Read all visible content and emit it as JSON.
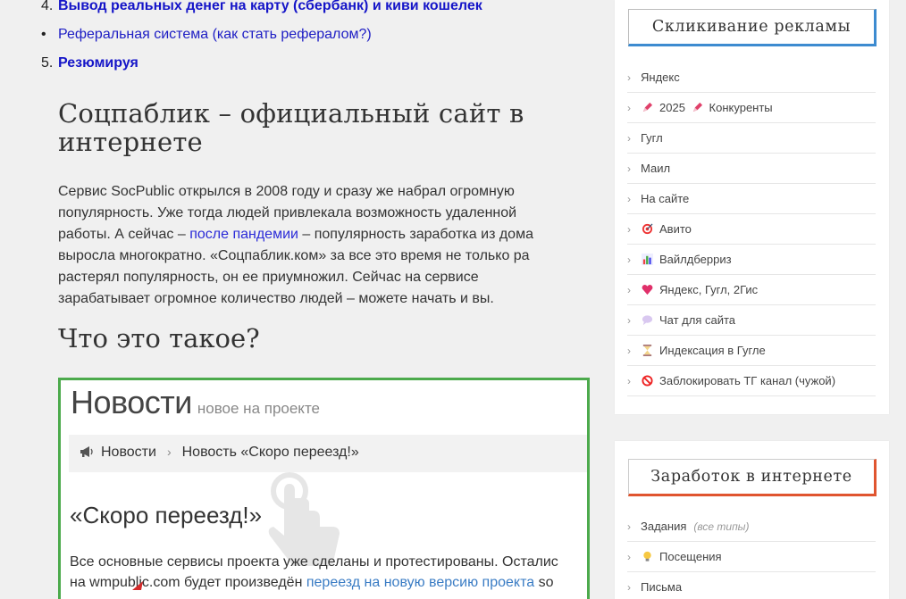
{
  "toc": {
    "item4_num": "4.",
    "item4_text": "Вывод реальных денег на карту (сбербанк) и киви кошелек",
    "bullet_text": "Реферальная система (как стать рефералом?)",
    "item5_num": "5.",
    "item5_text": "Резюмируя"
  },
  "article": {
    "title": "Соцпаблик – официальный сайт в интернете",
    "intro_1": "Сервис SocPublic открылся в 2008 году и сразу же набрал огромную популярность. Уже тогда людей привлекала возможность удаленной работы. А сейчас – ",
    "intro_link": "после пандемии",
    "intro_2": " – популярность заработка из дома выросла многократно. «Соцпаблик.ком» за все это время не только ра растерял популярность, он ее приумножил. Сейчас на сервисе зарабатывает огромное количество людей – можете начать и вы.",
    "subtitle": "Что это такое?"
  },
  "screenshot": {
    "title": "Новости",
    "subtitle": "новое на проекте",
    "crumb_1": "Новости",
    "crumb_2": "Новость «Скоро переезд!»",
    "heading": "«Скоро переезд!»",
    "para_line1": "Все основные сервисы проекта уже сделаны и протестированы. Осталис",
    "para_line2_start": "на wmpublic.com будет произведён ",
    "para_line2_link": "переезд на новую версию проекта",
    "para_line2_end": " so"
  },
  "sidebar": {
    "widget1": {
      "title": "Скликивание рекламы",
      "items": [
        {
          "icon": "",
          "label": "Яндекс"
        },
        {
          "icon": "pen-icon",
          "label": "2025",
          "label2": "Конкуренты"
        },
        {
          "icon": "",
          "label": "Гугл"
        },
        {
          "icon": "",
          "label": "Маил"
        },
        {
          "icon": "",
          "label": "На сайте"
        },
        {
          "icon": "target-icon",
          "label": "Авито"
        },
        {
          "icon": "chart-icon",
          "label": "Вайлдберриз"
        },
        {
          "icon": "heart-icon",
          "label": "Яндекс, Гугл, 2Гис"
        },
        {
          "icon": "speech-bubble-icon",
          "label": "Чат для сайта"
        },
        {
          "icon": "hourglass-icon",
          "label": "Индексация в Гугле"
        },
        {
          "icon": "prohibited-icon",
          "label": "Заблокировать ТГ канал (чужой)"
        }
      ]
    },
    "widget2": {
      "title": "Заработок в интернете",
      "items": [
        {
          "icon": "",
          "label": "Задания",
          "hint": "(все типы)"
        },
        {
          "icon": "lightbulb-icon",
          "label": "Посещения"
        },
        {
          "icon": "",
          "label": "Письма"
        }
      ]
    }
  },
  "colors": {
    "toc_link": "#1d1dc4",
    "screenshot_border": "#4caa4c",
    "widget1_accent": "#3d8bd0",
    "widget2_accent": "#e0552f"
  }
}
